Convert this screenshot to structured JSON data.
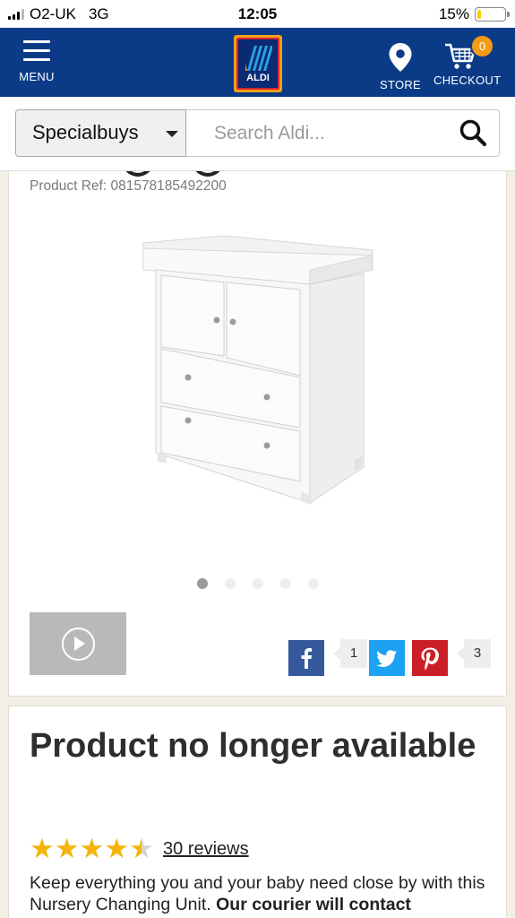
{
  "status_bar": {
    "carrier": "O2-UK",
    "network": "3G",
    "time": "12:05",
    "battery": "15%",
    "battery_level": 0.15
  },
  "header": {
    "menu_label": "MENU",
    "logo_text": "ALDI",
    "store_label": "STORE",
    "checkout_label": "CHECKOUT",
    "cart_count": "0",
    "brand_color": "#0b3b87",
    "badge_color": "#f59a14"
  },
  "search": {
    "category": "Specialbuys",
    "placeholder": "Search Aldi...",
    "value": ""
  },
  "product": {
    "ref": "Product Ref: 081578185492200",
    "image_icon": "changing-unit-image",
    "carousel": {
      "count": 5,
      "active": 0
    },
    "video_icon": "play-icon",
    "share": {
      "facebook_count": "1",
      "pinterest_count": "3"
    }
  },
  "availability": {
    "heading": "Product no longer available",
    "rating": 4.5,
    "reviews_link": "30 reviews",
    "description_plain": "Keep everything you and your baby need close by with this Nursery Changing Unit.",
    "description_bold": "Our courier will contact"
  }
}
